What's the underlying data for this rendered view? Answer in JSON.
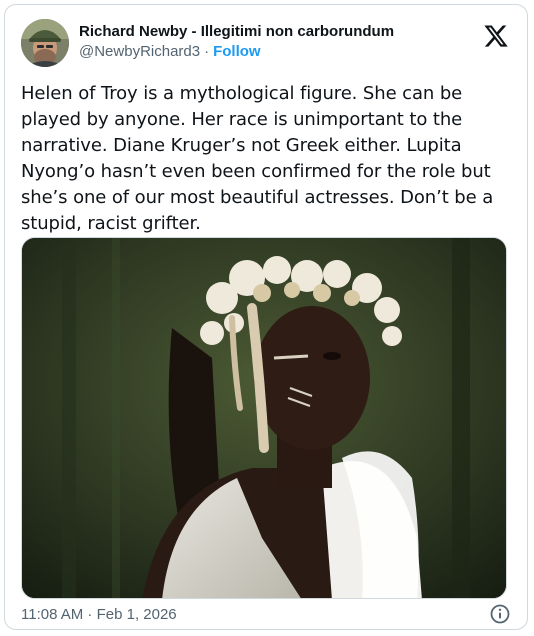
{
  "author": {
    "display_name": "Richard Newby - Illegitimi non carborundum",
    "handle": "@NewbyRichard3",
    "separator": "·",
    "follow_label": "Follow",
    "avatar_icon": "user-avatar"
  },
  "brand": {
    "logo_icon": "x-logo-icon"
  },
  "tweet": {
    "text": "Helen of Troy is a mythological figure. She can be played by anyone. Her race is unimportant to the narrative. Diane Kruger’s not Greek either. Lupita Nyong’o hasn’t even been confirmed for the role but she’s one of our most beautiful actresses. Don’t be a stupid, racist grifter."
  },
  "media": {
    "type": "photo"
  },
  "footer": {
    "timestamp": "11:08 AM · Feb 1, 2026",
    "info_icon": "info-icon"
  },
  "colors": {
    "accent": "#1d9bf0",
    "text_primary": "#0f1419",
    "text_secondary": "#536471",
    "border": "#cfd9de"
  }
}
